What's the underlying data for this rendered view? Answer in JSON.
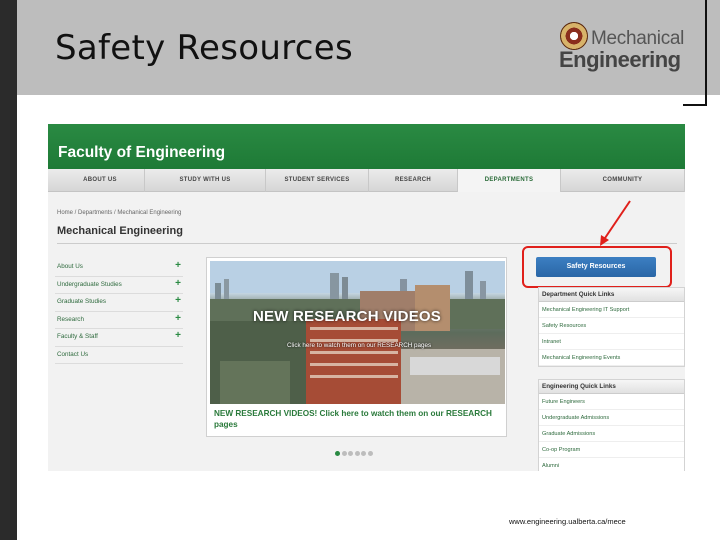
{
  "slide": {
    "title": "Safety Resources",
    "logo": {
      "line1": "Mechanical",
      "line2": "Engineering"
    },
    "url": "www.engineering.ualberta.ca/mece"
  },
  "site": {
    "brand": "Faculty of Engineering",
    "nav": [
      "ABOUT US",
      "STUDY WITH US",
      "STUDENT SERVICES",
      "RESEARCH",
      "DEPARTMENTS",
      "COMMUNITY"
    ],
    "nav_active_index": 4,
    "breadcrumb": "Home / Departments / Mechanical Engineering",
    "page_heading": "Mechanical Engineering",
    "sidenav": [
      {
        "label": "About Us",
        "has_plus": true
      },
      {
        "label": "Undergraduate Studies",
        "has_plus": true
      },
      {
        "label": "Graduate Studies",
        "has_plus": true
      },
      {
        "label": "Research",
        "has_plus": true
      },
      {
        "label": "Faculty & Staff",
        "has_plus": true
      },
      {
        "label": "Contact Us",
        "has_plus": false
      }
    ],
    "plus_symbol": "+",
    "hero": {
      "overlay_title": "NEW RESEARCH VIDEOS",
      "overlay_sub": "Click here to watch them on our RESEARCH pages",
      "caption": "NEW RESEARCH VIDEOS! Click here to watch them on our RESEARCH pages",
      "slide_count": 6,
      "active_slide": 1
    },
    "safety_button": "Safety Resources",
    "department_links": {
      "heading": "Department Quick Links",
      "items": [
        "Mechanical Engineering IT Support",
        "Safety Resources",
        "Intranet",
        "Mechanical Engineering Events"
      ]
    },
    "engineering_links": {
      "heading": "Engineering Quick Links",
      "items": [
        "Future Engineers",
        "Undergraduate Admissions",
        "Graduate Admissions",
        "Co-op Program",
        "Alumni"
      ]
    }
  },
  "colors": {
    "header_gray": "#bdbdbd",
    "green": "#2a8a43",
    "button_blue": "#2a66a6",
    "highlight_red": "#e0201b"
  }
}
